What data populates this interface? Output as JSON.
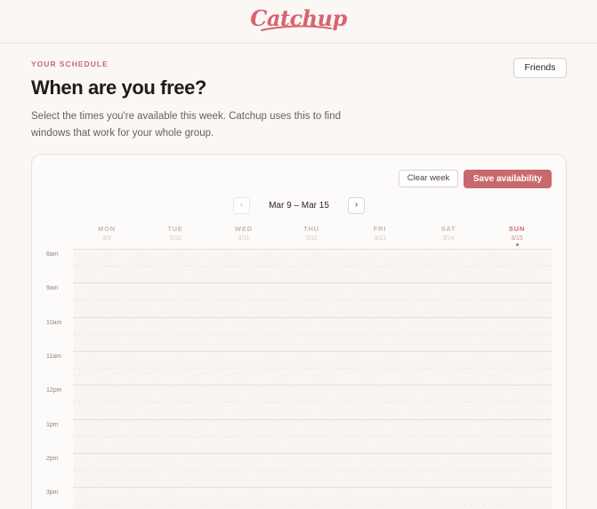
{
  "header": {
    "logo_text": "Catchup"
  },
  "page": {
    "eyebrow": "YOUR SCHEDULE",
    "title": "When are you free?",
    "subtitle": "Select the times you're available this week. Catchup uses this to find windows that work for your whole group.",
    "friends_label": "Friends"
  },
  "toolbar": {
    "clear_label": "Clear week",
    "save_label": "Save availability"
  },
  "week": {
    "range": "Mar 9 – Mar 15",
    "prev_icon": "chevron-left-icon",
    "next_icon": "chevron-right-icon",
    "days": [
      {
        "name": "MON",
        "date": "3/9",
        "today": false
      },
      {
        "name": "TUE",
        "date": "3/10",
        "today": false
      },
      {
        "name": "WED",
        "date": "3/11",
        "today": false
      },
      {
        "name": "THU",
        "date": "3/12",
        "today": false
      },
      {
        "name": "FRI",
        "date": "3/13",
        "today": false
      },
      {
        "name": "SAT",
        "date": "3/14",
        "today": false
      },
      {
        "name": "SUN",
        "date": "3/15",
        "today": true
      }
    ]
  },
  "hours": [
    "8am",
    "9am",
    "10am",
    "11am",
    "12pm",
    "1pm",
    "2pm",
    "3pm"
  ],
  "colors": {
    "accent": "#c8696d",
    "logo": "#d8646e",
    "background": "#fbf7f5"
  }
}
